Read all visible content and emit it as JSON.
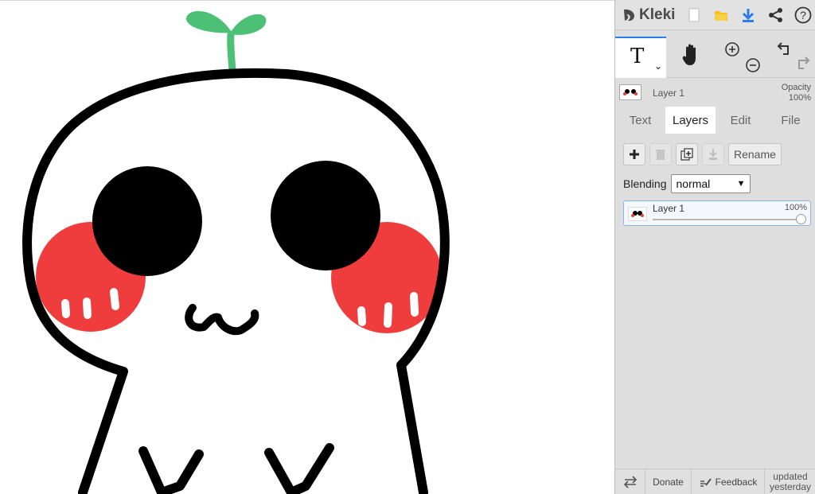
{
  "app": {
    "name": "Kleki"
  },
  "layer_info": {
    "name": "Layer 1",
    "opacity_label": "Opacity",
    "opacity_value": "100%"
  },
  "tabs": [
    {
      "label": "Text",
      "active": false
    },
    {
      "label": "Layers",
      "active": true
    },
    {
      "label": "Edit",
      "active": false
    },
    {
      "label": "File",
      "active": false
    }
  ],
  "layers_panel": {
    "rename_label": "Rename",
    "blending_label": "Blending",
    "blending_value": "normal",
    "layers": [
      {
        "name": "Layer 1",
        "opacity": "100%",
        "opacity_fraction": 1.0
      }
    ]
  },
  "bottom_bar": {
    "donate_label": "Donate",
    "feedback_label": "Feedback",
    "updated_line1": "updated",
    "updated_line2": "yesterday"
  },
  "colors": {
    "accent": "#2b7de9",
    "sprout": "#4cc074",
    "cheek": "#ee3d3c",
    "outline": "#000000",
    "panel_bg": "#dedede"
  },
  "icons": {
    "topbar": [
      "kleki-logo-icon",
      "new-image-icon",
      "open-folder-icon",
      "download-icon",
      "share-icon",
      "help-icon"
    ],
    "tools": [
      "text-tool-icon",
      "hand-tool-icon",
      "zoom-in-icon",
      "zoom-out-icon",
      "undo-icon",
      "redo-icon"
    ],
    "layer_buttons": [
      "add-layer-icon",
      "delete-layer-icon",
      "duplicate-layer-icon",
      "merge-down-icon"
    ],
    "bottom": [
      "swap-sides-icon",
      "feedback-icon"
    ]
  }
}
